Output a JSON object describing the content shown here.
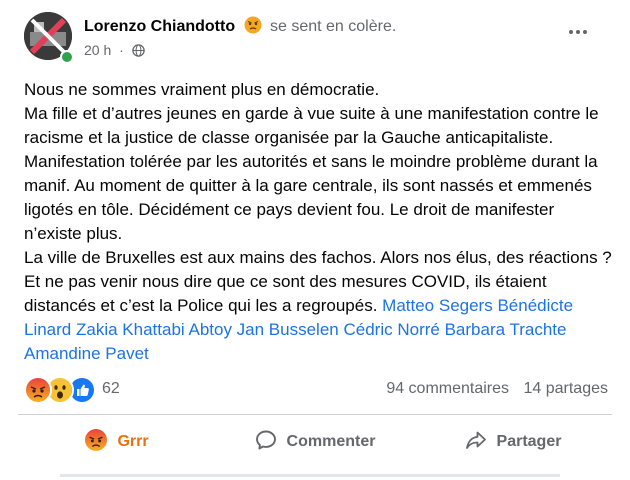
{
  "post": {
    "author": "Lorenzo Chiandotto",
    "feeling": "se sent en colère.",
    "time": "20 h",
    "separator": "·",
    "paragraph_lines": [
      "Nous ne sommes vraiment plus en démocratie.",
      "Ma fille et d’autres jeunes en garde à vue suite à une manifestation contre le racisme et la justice de classe organisée par la Gauche anticapitaliste. Manifestation tolérée par les autorités et sans le moindre problème durant la manif. Au moment de quitter à la gare centrale, ils sont nassés et emmenés ligotés en tôle. Décidément ce pays devient fou. Le droit de manifester n’existe plus.",
      "La ville de Bruxelles est aux mains des fachos. Alors nos élus, des réactions ? Et ne pas venir nous dire que ce sont des mesures COVID, ils étaient distancés et c’est la Police qui les a regroupés."
    ],
    "tags": [
      "Matteo Segers",
      "Bénédicte Linard",
      "Zakia Khattabi",
      "Abtoy Jan Busselen",
      "Cédric Norré",
      "Barbara Trachte",
      "Amandine Pavet"
    ]
  },
  "stats": {
    "reaction_icons": [
      "angry-face-icon",
      "surprised-face-icon",
      "like-thumb-icon"
    ],
    "reaction_count": "62",
    "comments": "94 commentaires",
    "shares": "14 partages"
  },
  "actions": {
    "react_label": "Grrr",
    "comment_label": "Commenter",
    "share_label": "Partager"
  },
  "colors": {
    "link": "#1b74e4",
    "secondary_text": "#65676b",
    "grrr": "#e9710f",
    "online": "#31a24c"
  }
}
